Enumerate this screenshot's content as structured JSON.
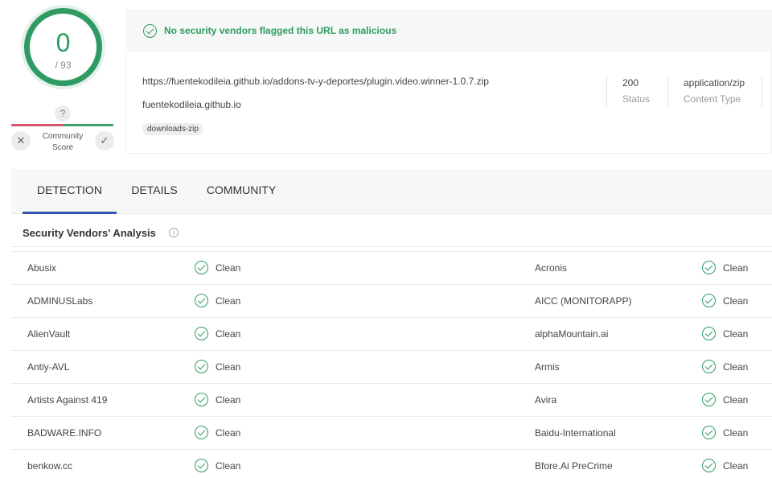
{
  "score": {
    "detections": "0",
    "total": "/ 93"
  },
  "community": {
    "unknown_icon": "?",
    "label_line1": "Community",
    "label_line2": "Score"
  },
  "banner": {
    "message": "No security vendors flagged this URL as malicious"
  },
  "url_info": {
    "url": "https://fuentekodileia.github.io/addons-tv-y-deportes/plugin.video.winner-1.0.7.zip",
    "domain": "fuentekodileia.github.io",
    "tag": "downloads-zip",
    "status_value": "200",
    "status_label": "Status",
    "content_type_value": "application/zip",
    "content_type_label": "Content Type"
  },
  "tabs": [
    {
      "label": "DETECTION"
    },
    {
      "label": "DETAILS"
    },
    {
      "label": "COMMUNITY"
    }
  ],
  "section": {
    "title": "Security Vendors' Analysis",
    "info_icon": "i"
  },
  "vendors": [
    {
      "left": "Abusix",
      "left_status": "Clean",
      "right": "Acronis",
      "right_status": "Clean"
    },
    {
      "left": "ADMINUSLabs",
      "left_status": "Clean",
      "right": "AICC (MONITORAPP)",
      "right_status": "Clean"
    },
    {
      "left": "AlienVault",
      "left_status": "Clean",
      "right": "alphaMountain.ai",
      "right_status": "Clean"
    },
    {
      "left": "Antiy-AVL",
      "left_status": "Clean",
      "right": "Armis",
      "right_status": "Clean"
    },
    {
      "left": "Artists Against 419",
      "left_status": "Clean",
      "right": "Avira",
      "right_status": "Clean"
    },
    {
      "left": "BADWARE.INFO",
      "left_status": "Clean",
      "right": "Baidu-International",
      "right_status": "Clean"
    },
    {
      "left": "benkow.cc",
      "left_status": "Clean",
      "right": "Bfore.Ai PreCrime",
      "right_status": "Clean"
    }
  ],
  "colors": {
    "clean_green": "#2f9b63",
    "tab_active": "#3b53b5",
    "malicious_red": "#d9576c"
  },
  "icons": {
    "community_down": "close-icon",
    "community_up": "check-icon",
    "status": "check-circle-icon"
  }
}
